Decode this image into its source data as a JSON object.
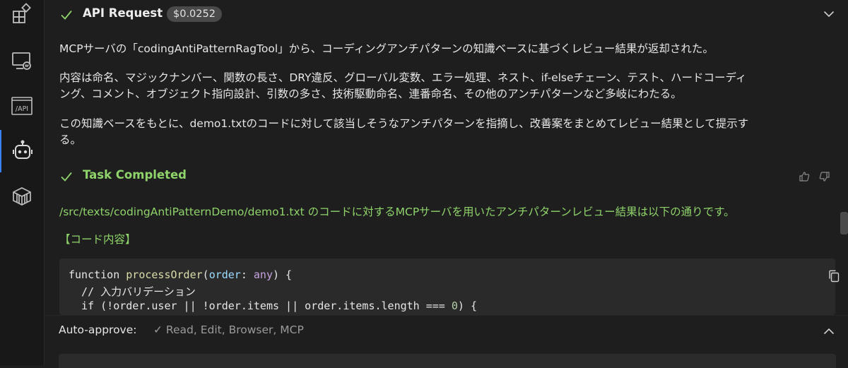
{
  "activity_bar": {
    "items": [
      {
        "icon": "extensions-icon"
      },
      {
        "icon": "remote-explorer-icon"
      },
      {
        "icon": "api-icon",
        "label": "/API"
      },
      {
        "icon": "robot-agent-icon",
        "active": true
      },
      {
        "icon": "package-icon"
      }
    ]
  },
  "api_request": {
    "title": "API Request",
    "cost": "$0.0252"
  },
  "message": {
    "p1": "MCPサーバの「codingAntiPatternRagTool」から、コーディングアンチパターンの知識ベースに基づくレビュー結果が返却された。",
    "p2_line1": "内容は命名、マジックナンバー、関数の長さ、DRY違反、グローバル変数、エラー処理、ネスト、if-elseチェーン、テスト、ハードコーディ",
    "p2_line2": "ング、コメント、オブジェクト指向設計、引数の多さ、技術駆動命名、連番命名、その他のアンチパターンなど多岐にわたる。",
    "p3_line1": "この知識ベースをもとに、demo1.txtのコードに対して該当しそうなアンチパターンを指摘し、改善案をまとめてレビュー結果として提示す",
    "p3_line2": "る。"
  },
  "task": {
    "title": "Task Completed",
    "summary": "/src/texts/codingAntiPatternDemo/demo1.txt のコードに対するMCPサーバを用いたアンチパターンレビュー結果は以下の通りです。",
    "section_heading": "【コード内容】"
  },
  "code": {
    "line1": {
      "kw": "function ",
      "fn": "processOrder",
      "p1": "(",
      "param": "order",
      "p2": ": ",
      "type": "any",
      "p3": ") {"
    },
    "line2": "  // 入力バリデーション",
    "line3": {
      "a": "  if (!order.user || !order.items || order.items.length === ",
      "num": "0",
      "b": ") {"
    }
  },
  "auto_approve": {
    "label": "Auto-approve:",
    "values": "✓ Read, Edit, Browser, MCP"
  },
  "colors": {
    "accent_green": "#8fd46b",
    "active_indicator": "#3b82f6"
  }
}
